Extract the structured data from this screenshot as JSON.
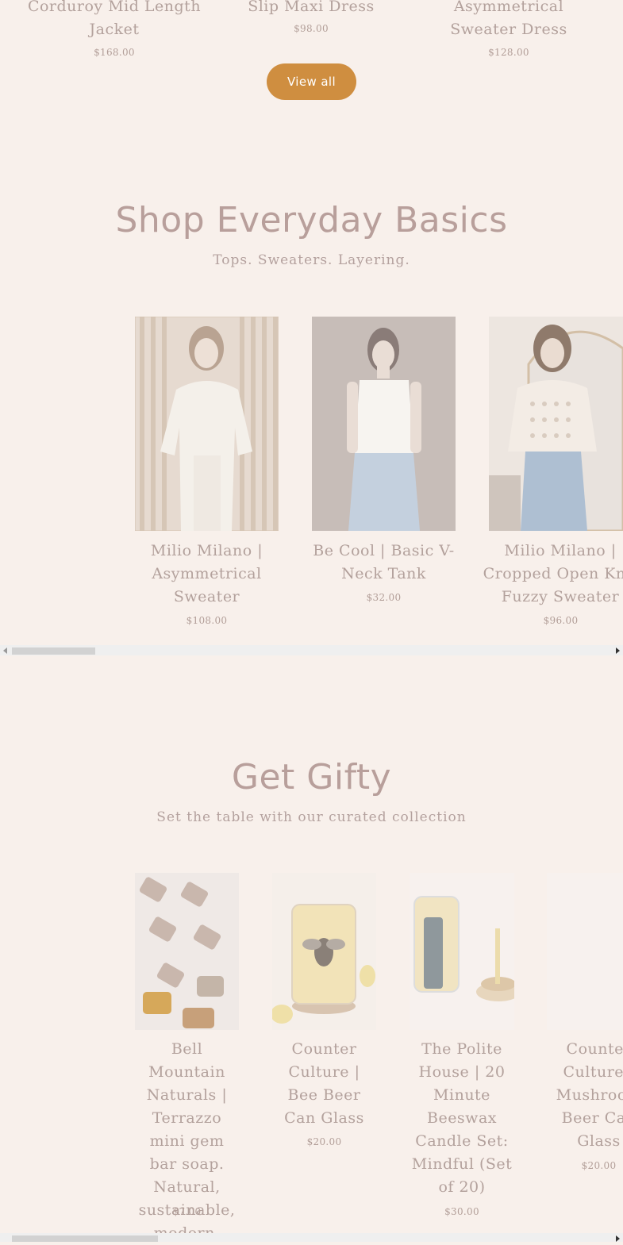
{
  "top_products": [
    {
      "title": "Corduroy Mid Length Jacket",
      "price": "$168.00"
    },
    {
      "title": "Slip Maxi Dress",
      "price": "$98.00"
    },
    {
      "title": "Asymmetrical Sweater Dress",
      "price": "$128.00"
    }
  ],
  "view_all_label": "View all",
  "basics": {
    "heading": "Shop Everyday Basics",
    "subheading": "Tops. Sweaters. Layering.",
    "products": [
      {
        "title": "Milio Milano | Asymmetrical Sweater",
        "price": "$108.00"
      },
      {
        "title": "Be Cool | Basic V-Neck Tank",
        "price": "$32.00"
      },
      {
        "title": "Milio Milano | Cropped Open Knit Fuzzy Sweater",
        "price": "$96.00"
      }
    ]
  },
  "gifty": {
    "heading": "Get Gifty",
    "subheading": "Set the table with our curated collection",
    "products": [
      {
        "title": "Bell Mountain Naturals | Terrazzo mini gem bar soap. Natural, sustainable, modern.",
        "price": "$7.00"
      },
      {
        "title": "Counter Culture | Bee Beer Can Glass",
        "price": "$20.00"
      },
      {
        "title": "The Polite House | 20 Minute Beeswax Candle Set: Mindful (Set of 20)",
        "price": "$30.00"
      },
      {
        "title": "Counter Culture | Mushroom Beer Can Glass",
        "price": "$20.00"
      }
    ]
  },
  "colors": {
    "background": "#f8f0eb",
    "button": "#cf8e40",
    "text": "#b3a19c"
  }
}
